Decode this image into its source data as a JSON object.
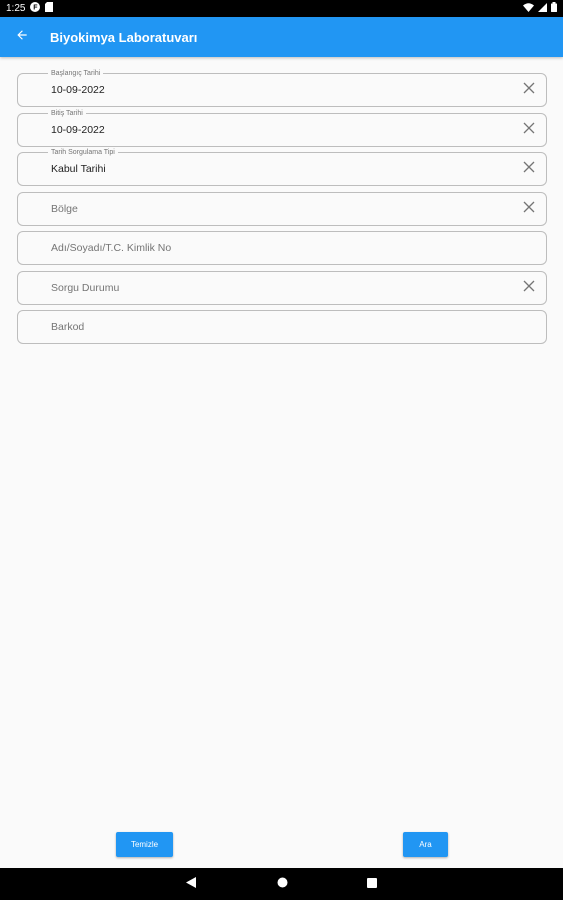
{
  "status_bar": {
    "time": "1:25",
    "icons": [
      "f-icon",
      "sim-card-icon",
      "wifi-icon",
      "signal-icon",
      "battery-icon"
    ]
  },
  "app_bar": {
    "title": "Biyokimya Laboratuvarı",
    "back_icon": "arrow-left-icon"
  },
  "form": {
    "start_date": {
      "label": "Başlangıç Tarihi",
      "value": "10-09-2022"
    },
    "end_date": {
      "label": "Bitiş Tarihi",
      "value": "10-09-2022"
    },
    "date_query_type": {
      "label": "Tarih Sorgulama Tipi",
      "value": "Kabul Tarihi"
    },
    "region": {
      "placeholder": "Bölge"
    },
    "name_id": {
      "placeholder": "Adı/Soyadı/T.C. Kimlik No"
    },
    "query_status": {
      "placeholder": "Sorgu Durumu"
    },
    "barcode": {
      "placeholder": "Barkod"
    }
  },
  "buttons": {
    "clear_label": "Temizle",
    "search_label": "Ara"
  },
  "colors": {
    "primary": "#2196f3",
    "background": "#fafafa",
    "border": "#bdbdbd"
  }
}
